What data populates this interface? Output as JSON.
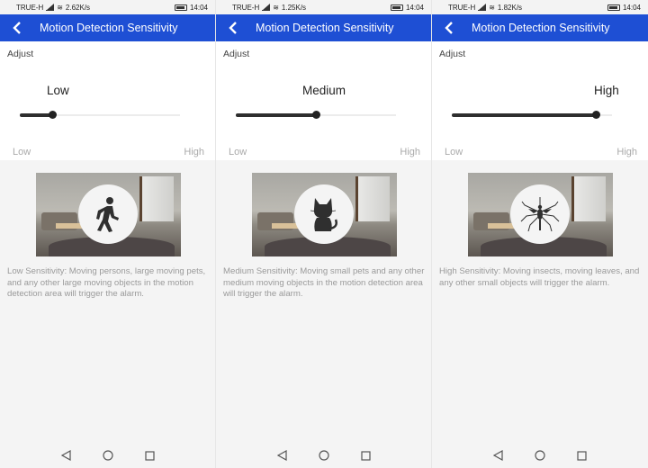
{
  "screens": [
    {
      "status": {
        "carrier": "TRUE-H",
        "speed": "2.62K/s",
        "battery": "100",
        "time": "14:04"
      },
      "header": {
        "title": "Motion Detection Sensitivity"
      },
      "adjust_label": "Adjust",
      "level_label": "Low",
      "slider": {
        "value_fraction": 0.2,
        "min_label": "Low",
        "max_label": "High"
      },
      "icon_name": "walking-person-icon",
      "description": "Low Sensitivity: Moving persons, large moving pets, and any other large moving objects in the motion detection area will trigger the alarm."
    },
    {
      "status": {
        "carrier": "TRUE-H",
        "speed": "1.25K/s",
        "battery": "100",
        "time": "14:04"
      },
      "header": {
        "title": "Motion Detection Sensitivity"
      },
      "adjust_label": "Adjust",
      "level_label": "Medium",
      "slider": {
        "value_fraction": 0.5,
        "min_label": "Low",
        "max_label": "High"
      },
      "icon_name": "cat-icon",
      "description": "Medium Sensitivity: Moving small pets and any other medium moving objects in the motion detection area will trigger the alarm."
    },
    {
      "status": {
        "carrier": "TRUE-H",
        "speed": "1.82K/s",
        "battery": "100",
        "time": "14:04"
      },
      "header": {
        "title": "Motion Detection Sensitivity"
      },
      "adjust_label": "Adjust",
      "level_label": "High",
      "slider": {
        "value_fraction": 0.9,
        "min_label": "Low",
        "max_label": "High"
      },
      "icon_name": "mosquito-icon",
      "description": "High Sensitivity: Moving insects, moving leaves, and any other small objects will trigger the alarm."
    }
  ],
  "colors": {
    "accent": "#1e4fd4",
    "slider": "#2e2e2e",
    "muted_text": "#9a9a9a"
  }
}
